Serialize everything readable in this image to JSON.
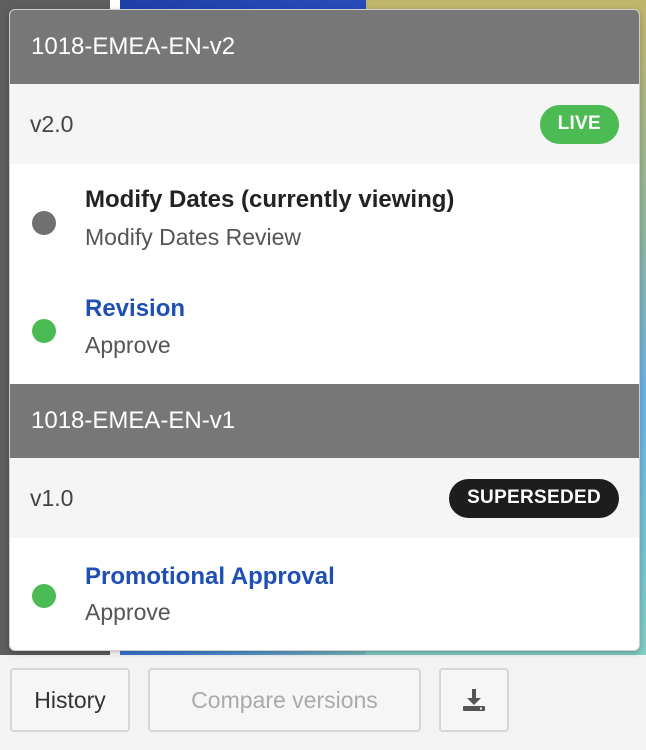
{
  "versions": [
    {
      "name": "1018-EMEA-EN-v2",
      "version": "v2.0",
      "status": "LIVE",
      "steps": [
        {
          "title": "Modify Dates (currently viewing)",
          "subtitle": "Modify Dates Review",
          "status": "current"
        },
        {
          "title": "Revision",
          "subtitle": "Approve",
          "status": "complete"
        }
      ]
    },
    {
      "name": "1018-EMEA-EN-v1",
      "version": "v1.0",
      "status": "SUPERSEDED",
      "steps": [
        {
          "title": "Promotional Approval",
          "subtitle": "Approve",
          "status": "complete"
        }
      ]
    }
  ],
  "footer": {
    "history_label": "History",
    "compare_label": "Compare versions",
    "download_icon": "download-icon"
  },
  "colors": {
    "header_bg": "#777777",
    "live": "#4cbb54",
    "superseded": "#1d1d1d",
    "link": "#1f4fb3",
    "current_dot": "#707070",
    "complete_dot": "#4cbb54"
  }
}
